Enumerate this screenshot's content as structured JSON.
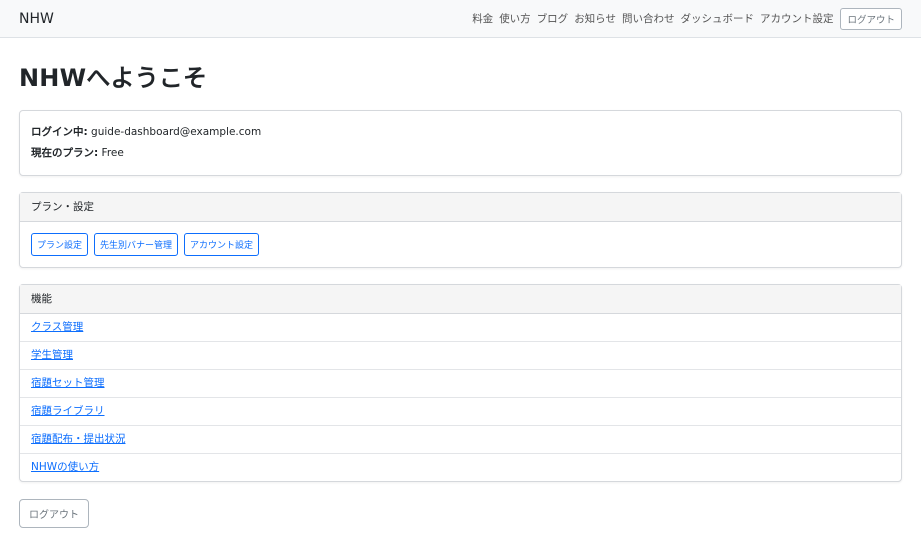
{
  "navbar": {
    "brand": "NHW",
    "links": [
      "料金",
      "使い方",
      "ブログ",
      "お知らせ",
      "問い合わせ",
      "ダッシュボード",
      "アカウント設定"
    ],
    "logout_label": "ログアウト"
  },
  "page": {
    "title": "NHWへようこそ"
  },
  "account": {
    "login_label": "ログイン中:",
    "login_value": "guide-dashboard@example.com",
    "plan_label": "現在のプラン:",
    "plan_value": "Free"
  },
  "plan_settings": {
    "header": "プラン・設定",
    "buttons": [
      "プラン設定",
      "先生別バナー管理",
      "アカウント設定"
    ]
  },
  "features": {
    "header": "機能",
    "items": [
      "クラス管理",
      "学生管理",
      "宿題セット管理",
      "宿題ライブラリ",
      "宿題配布・提出状況",
      "NHWの使い方"
    ]
  },
  "footer": {
    "logout_label": "ログアウト"
  }
}
